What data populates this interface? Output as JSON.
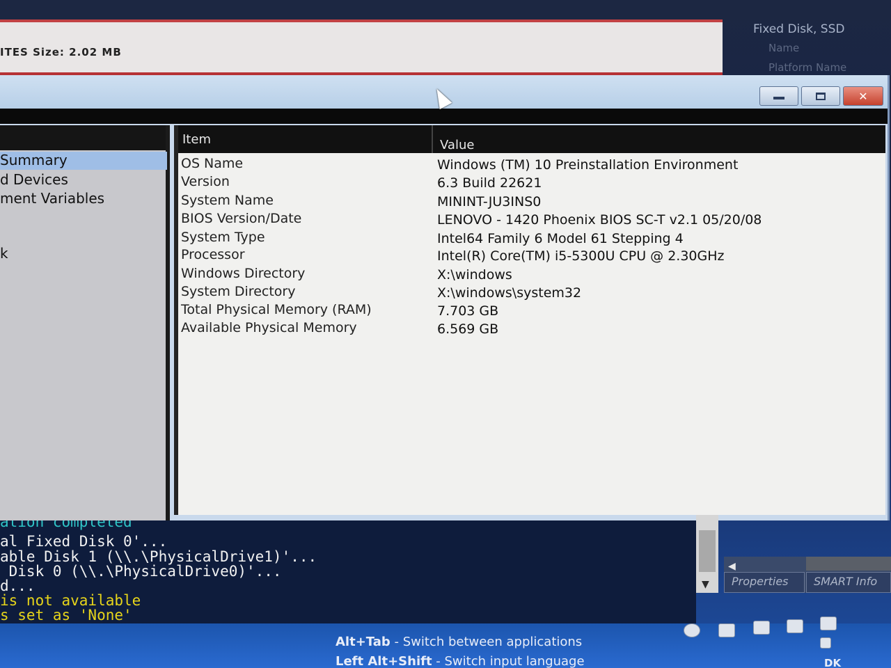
{
  "back_window": {
    "title_fragment": "ITES Size: 2.02 MB"
  },
  "disk_panel": {
    "title": "Fixed Disk, SSD",
    "line1": "Name",
    "line2": "Platform Name"
  },
  "window_controls": {
    "close_glyph": "✕"
  },
  "tree": {
    "items": [
      {
        "label": "Summary"
      },
      {
        "label": "d Devices"
      },
      {
        "label": "ment Variables"
      },
      {
        "label": "k"
      }
    ]
  },
  "list": {
    "headers": {
      "item": "Item",
      "value": "Value"
    },
    "rows": [
      {
        "item": "OS Name",
        "value": "Windows (TM) 10 Preinstallation Environment"
      },
      {
        "item": "Version",
        "value": "6.3 Build 22621"
      },
      {
        "item": "System Name",
        "value": "MININT-JU3INS0"
      },
      {
        "item": "BIOS Version/Date",
        "value": "LENOVO - 1420 Phoenix BIOS SC-T v2.1 05/20/08"
      },
      {
        "item": "System Type",
        "value": "Intel64 Family 6 Model 61 Stepping 4"
      },
      {
        "item": "Processor",
        "value": "Intel(R) Core(TM) i5-5300U CPU @ 2.30GHz"
      },
      {
        "item": "Windows Directory",
        "value": "X:\\windows"
      },
      {
        "item": "System Directory",
        "value": "X:\\windows\\system32"
      },
      {
        "item": "Total Physical Memory (RAM)",
        "value": "7.703 GB"
      },
      {
        "item": "Available Physical Memory",
        "value": "6.569 GB"
      }
    ]
  },
  "console": {
    "lines": [
      {
        "text": "ation completed"
      },
      {
        "text": "al Fixed Disk 0'..."
      },
      {
        "text": "able Disk 1 (\\\\.\\PhysicalDrive1)'..."
      },
      {
        "text": " Disk 0 (\\\\.\\PhysicalDrive0)'..."
      },
      {
        "text": "d..."
      },
      {
        "text": "is not available"
      },
      {
        "text": "s set as 'None'"
      }
    ]
  },
  "disk_tools": {
    "properties_label": "Properties",
    "smart_label": "SMART Info"
  },
  "taskbar": {
    "hint1_key": "Alt+Tab",
    "hint1_text": " - Switch between applications",
    "hint2_key": "Left Alt+Shift",
    "hint2_text": " - Switch input language",
    "locale": "DK"
  },
  "colors": {
    "selection": "#9fbee6",
    "console_bg": "#0e1c3c",
    "console_yellow": "#e7d51a",
    "console_cyan": "#2fc5c7",
    "taskbar": "#2a6ad0"
  }
}
